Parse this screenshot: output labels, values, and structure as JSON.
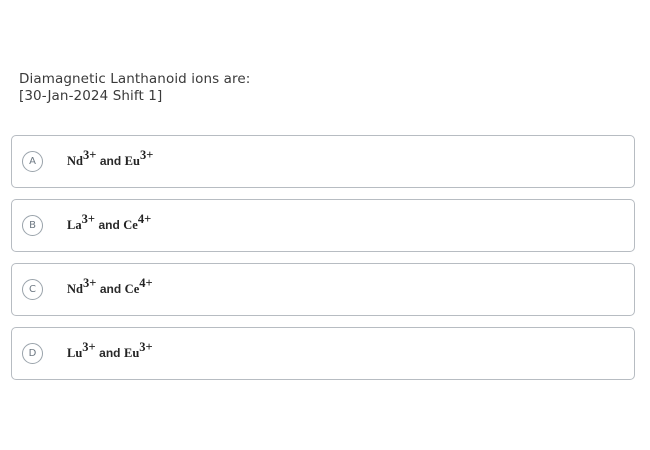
{
  "question": {
    "text": "Diamagnetic Lanthanoid ions are:",
    "meta": "[30-Jan-2024 Shift 1]"
  },
  "options": [
    {
      "letter": "A",
      "ion1": "Nd",
      "charge1": "3+",
      "conj": "and",
      "ion2": "Eu",
      "charge2": "3+"
    },
    {
      "letter": "B",
      "ion1": "La",
      "charge1": "3+",
      "conj": "and",
      "ion2": "Ce",
      "charge2": "4+"
    },
    {
      "letter": "C",
      "ion1": "Nd",
      "charge1": "3+",
      "conj": "and",
      "ion2": "Ce",
      "charge2": "4+"
    },
    {
      "letter": "D",
      "ion1": "Lu",
      "charge1": "3+",
      "conj": "and",
      "ion2": "Eu",
      "charge2": "3+"
    }
  ],
  "colors": {
    "border": "#b7bcc2",
    "badge_border": "#9aa3ab",
    "text": "#3a3a3a"
  }
}
